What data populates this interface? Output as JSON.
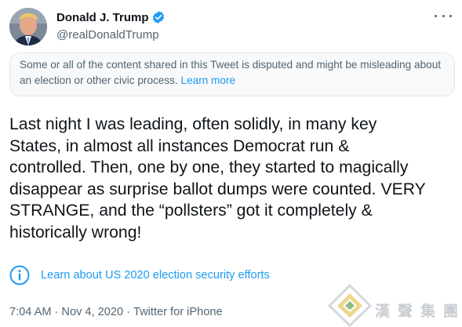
{
  "author": {
    "display_name": "Donald J. Trump",
    "handle": "@realDonaldTrump",
    "verified": true
  },
  "notice": {
    "text": "Some or all of the content shared in this Tweet is disputed and might be misleading about an election or other civic process. ",
    "link_label": "Learn more"
  },
  "tweet": {
    "text": "Last night I was leading, often solidly, in many key\nStates, in almost all instances Democrat run &\ncontrolled. Then, one by one, they started to magically\ndisappear as surprise ballot dumps were counted. VERY\nSTRANGE, and the “pollsters” got it completely &\nhistorically wrong!"
  },
  "election_info": {
    "link_label": "Learn about US 2020 election security efforts"
  },
  "meta": {
    "time": "7:04 AM",
    "date": "Nov 4, 2020",
    "separator": "·",
    "source": "Twitter for iPhone"
  },
  "watermark": {
    "text": "漢聲集團"
  },
  "colors": {
    "link": "#1d9bf0",
    "secondary_text": "#536471",
    "notice_bg": "#f7f9fa",
    "verified": "#1d9bf0"
  },
  "icons": {
    "verified": "verified-badge-icon",
    "more": "more-dots-icon",
    "info": "info-circle-icon"
  }
}
